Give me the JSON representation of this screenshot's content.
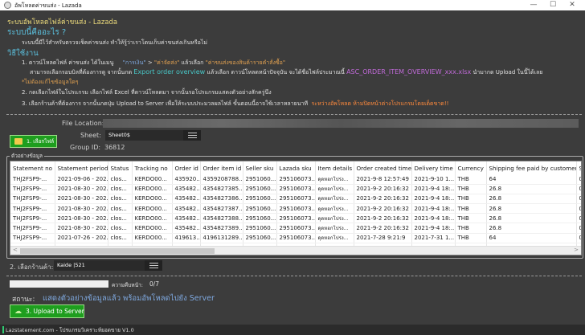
{
  "window": {
    "title": "อัพโหลดค่าขนส่ง - Lazada",
    "minimize": "—",
    "maximize": "☐",
    "close": "✕"
  },
  "header": {
    "app_title": "ระบบอัพโหลดไฟล์ค่าขนส่ง - Lazada",
    "what_heading": "ระบบนี้คืออะไร ?",
    "what_desc": "ระบบนี้มีไว้สำหรับตรวจเช็คค่าขนส่ง ทำให้รู้ว่าเราโดนเก็บค่าขนส่งเกินหรือไม่",
    "howto_heading": "วิธีใช้งาน"
  },
  "steps": {
    "s1a": "1. ดาวน์โหลดไฟล์ ค่าขนส่ง ได้ในเมนู",
    "s1_menu1": "\"การเงิน\"",
    "s1_gt": ">",
    "s1_menu2": "\"ค่าจัดส่ง\"",
    "s1_then": "แล้วเลือก",
    "s1_menu3": "\"ค่าขนส่งของสินค้ารายคำสั่งซื้อ\"",
    "s1b": "สามารถเลือกรอบบิลที่ต้องการดู จากนั้นกด",
    "s1_export": "Export order overview",
    "s1c": "แล้วเลือก ดาวน์โหลดหน้าปัจจุบัน จะได้ชื่อไฟล์ประมาณนี้",
    "s1_file": "ASC_ORDER_ITEM_OVERVIEW_xxx.xlsx",
    "s1d": "นำมากด Upload ในนี้ได้เลย",
    "note": "*ไม่ต้องแก้ไขข้อมูลใดๆ",
    "s2": "2. กดเลือกไฟล์ในโปรแกรม เลือกไฟล์ Excel ที่ดาวน์โหลดมา จากนั้นรอโปรแกรมแสดงตัวอย่างสักครู่นึง",
    "s3": "3. เลือกร้านค้าที่ต้องการ จากนั้นกดปุ่ม Upload to Server เพื่อให้ระบบประมวลผลไฟล์ ขั้นตอนนี้อาจใช้เวลาหลายนาที",
    "s3_warn": "ระหว่างอัพโหลด ห้ามปิดหน้าต่างโปรแกรมโดยเด็ดขาด!!"
  },
  "file": {
    "location_label": "File Location:",
    "location_value": "",
    "sheet_label": "Sheet:",
    "sheet_value": "Sheet0$",
    "group_label": "Group ID:",
    "group_value": "36812",
    "select_button": "1. เลือกไฟล์"
  },
  "preview": {
    "group_title": "ตัวอย่างข้อมูล",
    "columns": [
      "Statement no",
      "Statement period",
      "Status",
      "Tracking no",
      "Order id",
      "Order item id",
      "Seller sku",
      "Lazada sku",
      "Item details",
      "Order created time",
      "Delivery time",
      "Currency",
      "Shipping fee paid by customer",
      "S"
    ],
    "rows": [
      [
        "THJ2FSP9-...",
        "2021-09-06 - 202...",
        "clos...",
        "KERDO00...",
        "435920...",
        "4359208788...",
        "2951060...",
        "295106073...",
        "ดุดหอกโปร่ง...",
        "2021-9-8 12:57:49",
        "2021-9-10 1...",
        "THB",
        "64",
        "0"
      ],
      [
        "THJ2FSP9-...",
        "2021-08-30 - 202...",
        "clos...",
        "KERDO00...",
        "435482...",
        "4354827385...",
        "2951060...",
        "295106073...",
        "ดุดหอกโปร่ง...",
        "2021-9-2 20:16:32",
        "2021-9-4 18:...",
        "THB",
        "26.8",
        "0"
      ],
      [
        "THJ2FSP9-...",
        "2021-08-30 - 202...",
        "clos...",
        "KERDO00...",
        "435482...",
        "4354827386...",
        "2951060...",
        "295106073...",
        "ดุดหอกโปร่ง...",
        "2021-9-2 20:16:32",
        "2021-9-4 18:...",
        "THB",
        "26.8",
        "0"
      ],
      [
        "THJ2FSP9-...",
        "2021-08-30 - 202...",
        "clos...",
        "KERDO00...",
        "435482...",
        "4354827387...",
        "2951060...",
        "295106073...",
        "ดุดหอกโปร่ง...",
        "2021-9-2 20:16:32",
        "2021-9-4 18:...",
        "THB",
        "26.8",
        "0"
      ],
      [
        "THJ2FSP9-...",
        "2021-08-30 - 202...",
        "clos...",
        "KERDO00...",
        "435482...",
        "4354827388...",
        "2951060...",
        "295106073...",
        "ดุดหอกโปร่ง...",
        "2021-9-2 20:16:32",
        "2021-9-4 18:...",
        "THB",
        "26.8",
        "0"
      ],
      [
        "THJ2FSP9-...",
        "2021-08-30 - 202...",
        "clos...",
        "KERDO00...",
        "435482...",
        "4354827389...",
        "2951060...",
        "295106073...",
        "ดุดหอกโปร่ง...",
        "2021-9-2 20:16:32",
        "2021-9-4 18:...",
        "THB",
        "26.8",
        "0"
      ],
      [
        "THJ2FSP9-...",
        "2021-07-26 - 202...",
        "clos...",
        "KERDO00...",
        "419613...",
        "4196131289...",
        "2951060...",
        "295106073...",
        "ดุดหอกโปร่ง...",
        "2021-7-28 9:21:9",
        "2021-7-31 1...",
        "THB",
        "64",
        "0"
      ]
    ],
    "scroll_left": "<",
    "scroll_right": ">"
  },
  "shop": {
    "label": "2. เลือกร้านค้า:",
    "value": "Kaide |521"
  },
  "progress": {
    "label": "ความคืบหน้า:",
    "value": "0/7",
    "fraction": 0
  },
  "status": {
    "label": "สถานะ:",
    "value": "แสดงตัวอย่างข้อมูลแล้ว พร้อมอัพโหลดไปยัง Server"
  },
  "upload_button": "3. Upload to Server",
  "footer": "Lazstatement.com - โปรแกรมวิเคราะห์ยอดขาย V1.0"
}
